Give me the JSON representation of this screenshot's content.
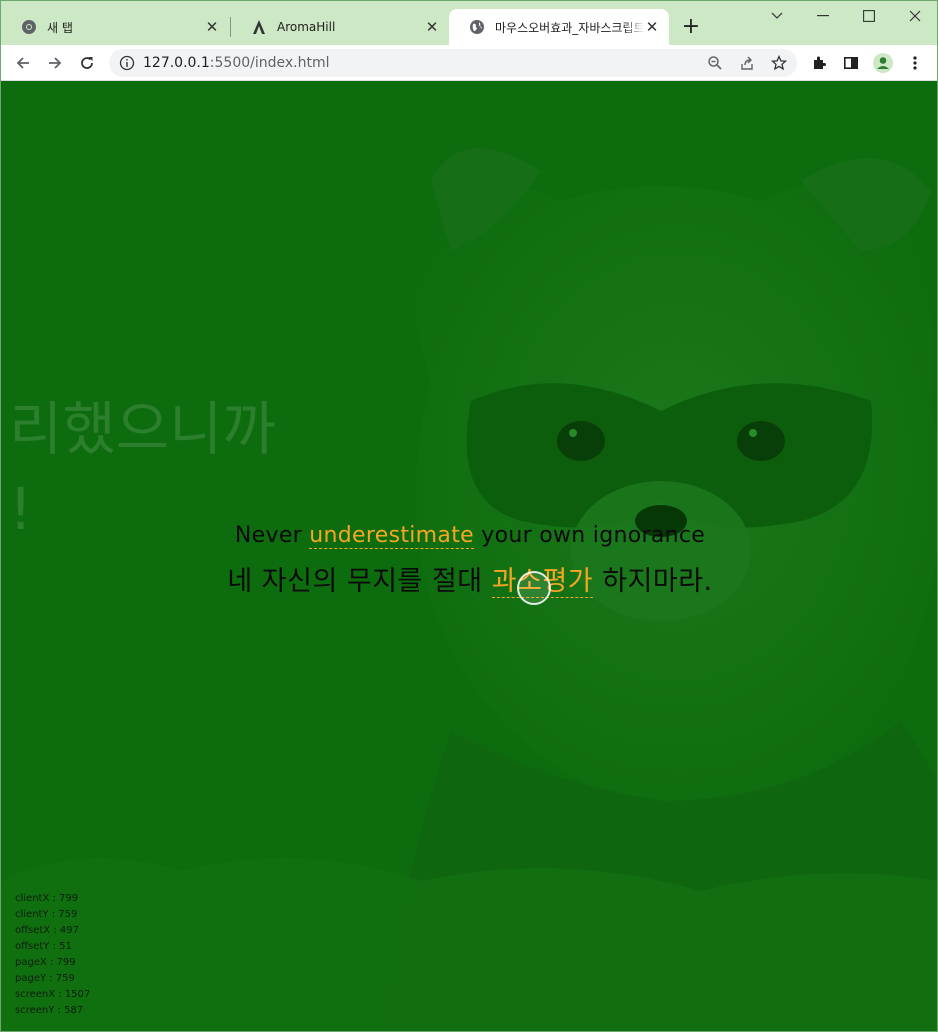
{
  "browser": {
    "tabs": [
      {
        "title": "새 탭",
        "icon": "chrome-icon"
      },
      {
        "title": "AromaHill",
        "icon": "aroma-logo-icon"
      },
      {
        "title": "마우스오버효과_자바스크립트",
        "icon": "globe-icon",
        "active": true
      }
    ],
    "url_host": "127.0.0.1",
    "url_rest": ":5500/index.html",
    "accent": "#cde8c4"
  },
  "page": {
    "background_color": "#0d6c0d",
    "highlight_color": "#f5a623",
    "ghost_text_line1": "리했으니까",
    "ghost_text_line2": "!",
    "quote_en_before": "Never ",
    "quote_en_highlight": "underestimate",
    "quote_en_after": " your own ignorance",
    "quote_ko_before": "네 자신의 무지를 절대 ",
    "quote_ko_highlight": "과소평가",
    "quote_ko_after": " 하지마라.",
    "coords": [
      "clientX : 799",
      "clientY : 759",
      "offsetX : 497",
      "offsetY : 51",
      "pageX : 799",
      "pageY : 759",
      "screenX : 1507",
      "screenY : 587"
    ]
  }
}
